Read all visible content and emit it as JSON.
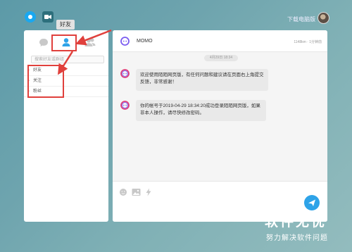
{
  "topbar": {
    "download_label": "下载电脑版"
  },
  "left": {
    "tabs": [
      {
        "name": "messages",
        "icon": "chat-bubble-icon"
      },
      {
        "name": "friends",
        "icon": "person-icon"
      },
      {
        "name": "groups",
        "icon": "group-icon"
      }
    ],
    "tooltip": "好友",
    "search_placeholder": "搜索好友或群组",
    "list_items": [
      {
        "label": "好友"
      },
      {
        "label": "关注"
      },
      {
        "label": "粉丝"
      }
    ]
  },
  "chat": {
    "title": "MOMO",
    "meta": "1148km · 1分钟前",
    "date": "4月29日 18:34",
    "messages": [
      {
        "text": "欢迎使用陌陌网页版，有任何问题和建议请在页面右上角提交反馈，非常感谢！"
      },
      {
        "text": "你的帐号于2019-04-29 18:34:20成功登录陌陌网页版，如果非本人操作，请尽快修改密码。"
      }
    ]
  },
  "watermark": {
    "main": "软件无忧",
    "sub": "努力解决软件问题"
  },
  "colors": {
    "accent": "#2ea3e8",
    "highlight": "#e0403c"
  }
}
